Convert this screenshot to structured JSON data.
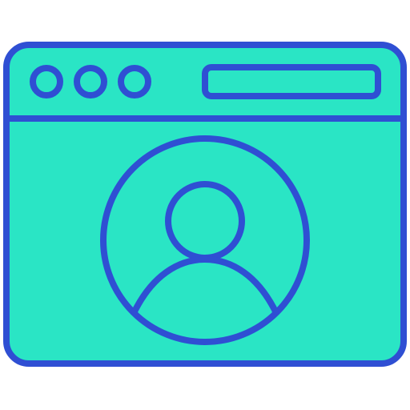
{
  "icon": {
    "name": "browser-window-user-profile-icon",
    "colors": {
      "fill": "#2AE5C5",
      "stroke": "#2F4FD3",
      "background": "#FFFFFF"
    },
    "window_controls": [
      "dot-1",
      "dot-2",
      "dot-3"
    ],
    "address_bar": "",
    "avatar": "user-icon"
  }
}
